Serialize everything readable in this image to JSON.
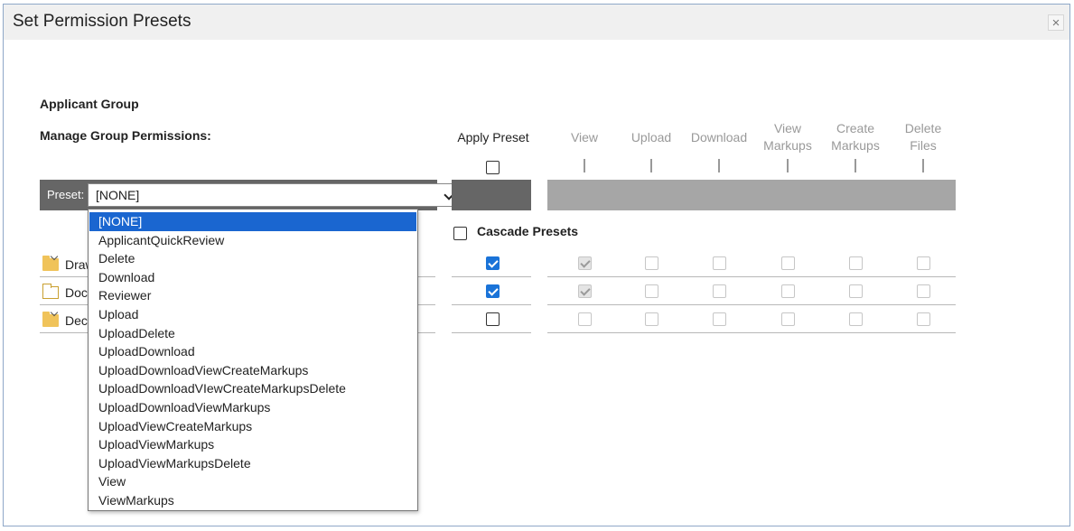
{
  "dialog": {
    "title": "Set Permission Presets",
    "close_glyph": "×"
  },
  "group_name": "Applicant Group",
  "manage_label": "Manage Group Permissions:",
  "apply_preset_label": "Apply Preset",
  "apply_preset_checked": false,
  "columns": [
    {
      "label": "View"
    },
    {
      "label": "Upload"
    },
    {
      "label": "Download"
    },
    {
      "label": "View\nMarkups"
    },
    {
      "label": "Create\nMarkups"
    },
    {
      "label": "Delete\nFiles"
    }
  ],
  "preset": {
    "label": "Preset:",
    "value": "[NONE]",
    "options": [
      "[NONE]",
      "ApplicantQuickReview",
      "Delete",
      "Download",
      "Reviewer",
      "Upload",
      "UploadDelete",
      "UploadDownload",
      "UploadDownloadViewCreateMarkups",
      "UploadDownloadVIewCreateMarkupsDelete",
      "UploadDownloadViewMarkups",
      "UploadViewCreateMarkups",
      "UploadViewMarkups",
      "UploadViewMarkupsDelete",
      "View",
      "ViewMarkups"
    ],
    "selected_index": 0
  },
  "cascade": {
    "label": "Cascade Presets",
    "checked": false
  },
  "rows": [
    {
      "name": "Draw",
      "folder": "filled",
      "apply": true,
      "perms": [
        true,
        false,
        false,
        false,
        false,
        false
      ]
    },
    {
      "name": "Doc",
      "folder": "empty",
      "apply": true,
      "perms": [
        true,
        false,
        false,
        false,
        false,
        false
      ]
    },
    {
      "name": "Dec",
      "folder": "filled",
      "apply": false,
      "perms": [
        false,
        false,
        false,
        false,
        false,
        false
      ]
    }
  ],
  "icons": {
    "close": "close-icon",
    "dropdown": "chevron-down-icon",
    "folder": "folder-icon"
  },
  "colors": {
    "selected_option": "#1a66d0",
    "checkbox_checked": "#1a73d8",
    "folder": "#f0c35a",
    "preset_bar": "#666666",
    "perm_bar": "#a6a6a6"
  }
}
